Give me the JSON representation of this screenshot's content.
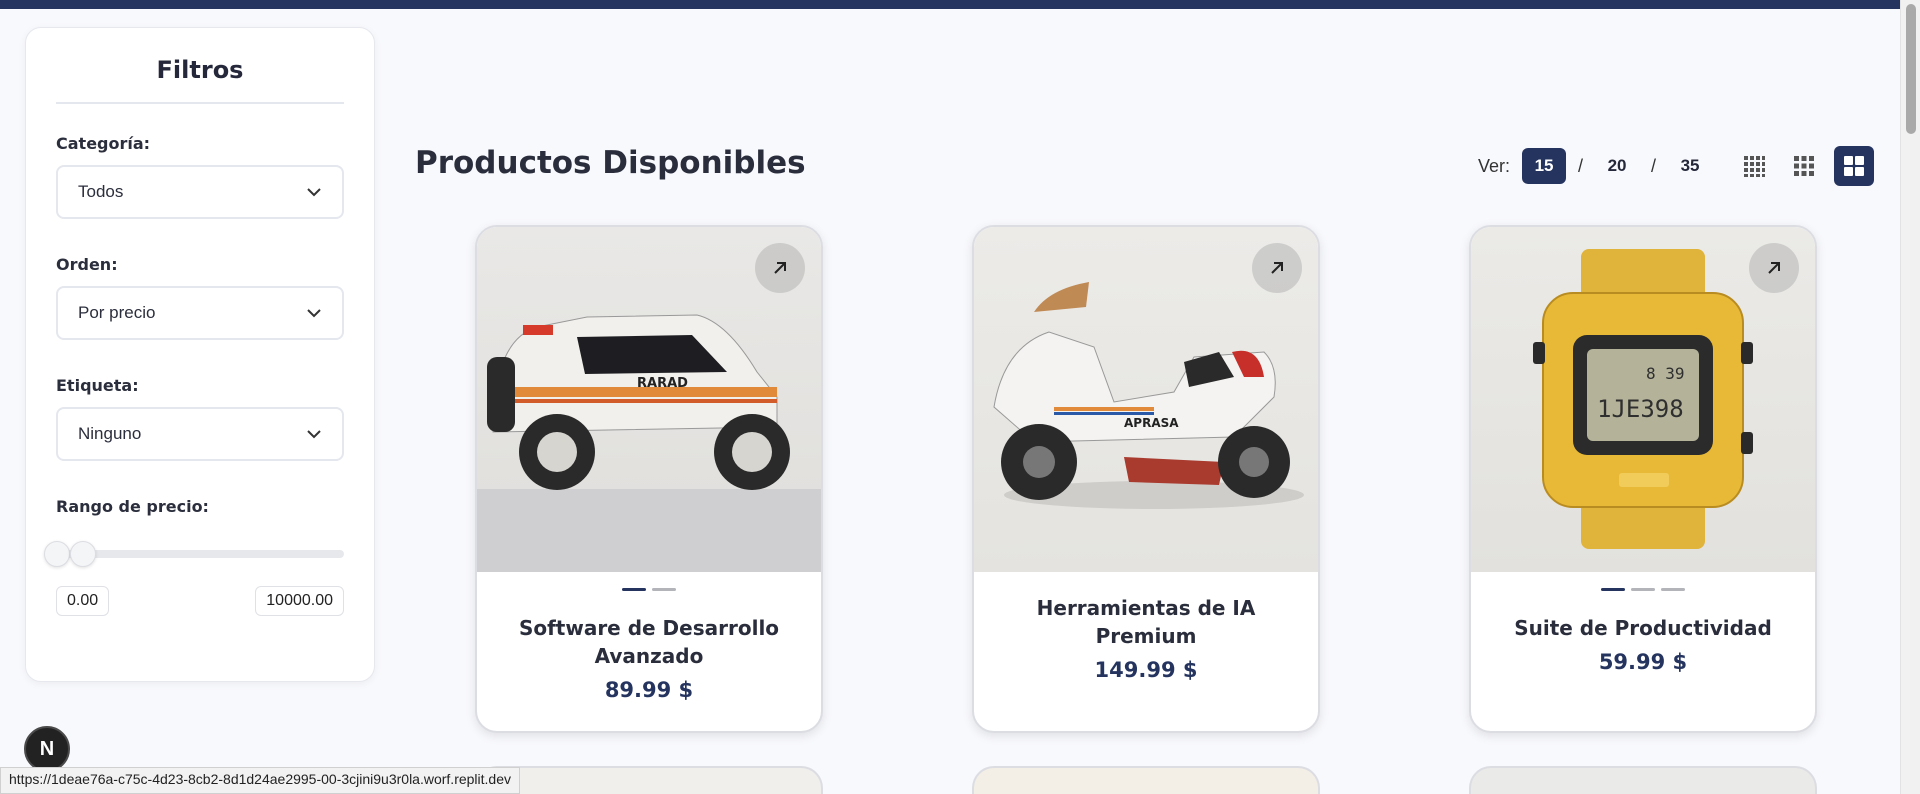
{
  "filters": {
    "title": "Filtros",
    "category": {
      "label": "Categoría:",
      "value": "Todos"
    },
    "order": {
      "label": "Orden:",
      "value": "Por precio"
    },
    "tag": {
      "label": "Etiqueta:",
      "value": "Ninguno"
    },
    "price_range": {
      "label": "Rango de precio:",
      "min": "0.00",
      "max": "10000.00"
    }
  },
  "main": {
    "title": "Productos Disponibles",
    "view": {
      "label": "Ver:",
      "options": [
        "15",
        "20",
        "35"
      ],
      "selected": "15"
    },
    "grid_modes": [
      "grid-small-icon",
      "grid-medium-icon",
      "grid-large-icon"
    ],
    "active_grid_mode": "grid-large-icon"
  },
  "products": [
    {
      "name": "Software de Desarrollo Avanzado",
      "price": "89.99 $",
      "image": "offroad-vehicle-image",
      "image_count": 2
    },
    {
      "name": "Herramientas de IA Premium",
      "price": "149.99 $",
      "image": "motorcycle-image",
      "image_count": 0
    },
    {
      "name": "Suite de Productividad",
      "price": "59.99 $",
      "image": "wristwatch-image",
      "image_count": 3
    }
  ],
  "badge": "N",
  "status_url": "https://1deae76a-c75c-4d23-8cb2-8d1d24ae2995-00-3cjini9u3r0la.worf.replit.dev",
  "colors": {
    "accent": "#25345f",
    "background": "#f8f9fd"
  }
}
